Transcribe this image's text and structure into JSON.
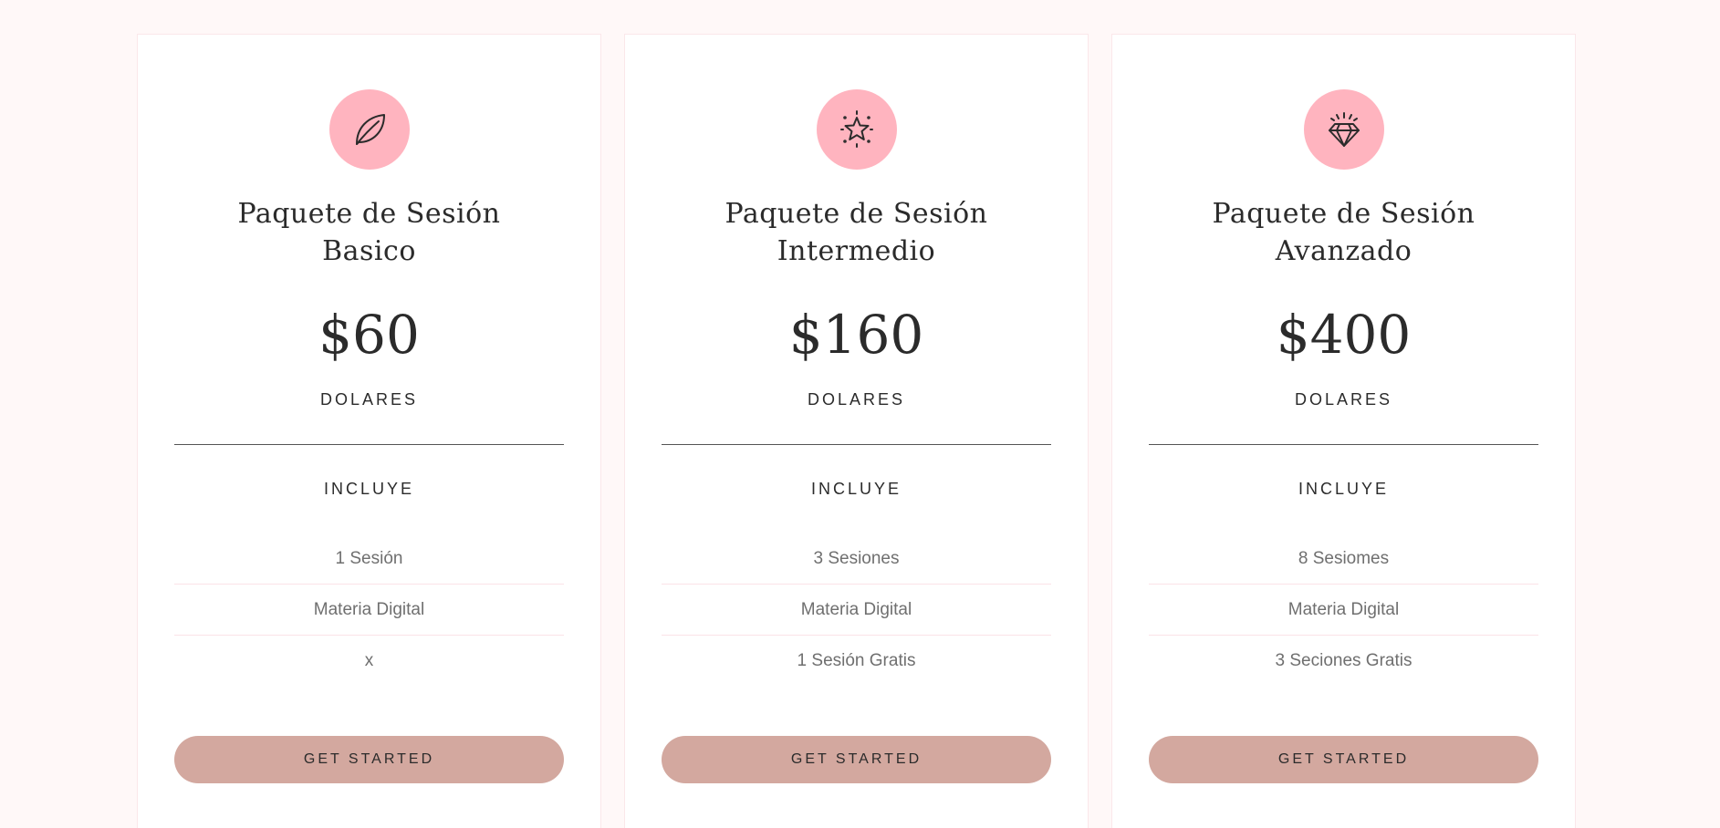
{
  "colors": {
    "page_background": "#fff8f8",
    "icon_circle": "#ffb4bf",
    "button": "#d3a89f",
    "text": "#2b2b2b",
    "feature_text": "#6f6f6f"
  },
  "plans": [
    {
      "icon": "leaf-icon",
      "title_line1": "Paquete de Sesión",
      "title_line2": "Basico",
      "price": "$60",
      "currency": "DOLARES",
      "includes_label": "INCLUYE",
      "features": [
        "1 Sesión",
        "Materia Digital",
        "x"
      ],
      "button_label": "GET STARTED"
    },
    {
      "icon": "star-icon",
      "title_line1": "Paquete de Sesión",
      "title_line2": "Intermedio",
      "price": "$160",
      "currency": "DOLARES",
      "includes_label": "INCLUYE",
      "features": [
        "3 Sesiones",
        "Materia Digital",
        "1 Sesión Gratis"
      ],
      "button_label": "GET STARTED"
    },
    {
      "icon": "diamond-icon",
      "title_line1": "Paquete de Sesión",
      "title_line2": "Avanzado",
      "price": "$400",
      "currency": "DOLARES",
      "includes_label": "INCLUYE",
      "features": [
        "8 Sesiomes",
        "Materia Digital",
        "3 Seciones Gratis"
      ],
      "button_label": "GET STARTED"
    }
  ]
}
